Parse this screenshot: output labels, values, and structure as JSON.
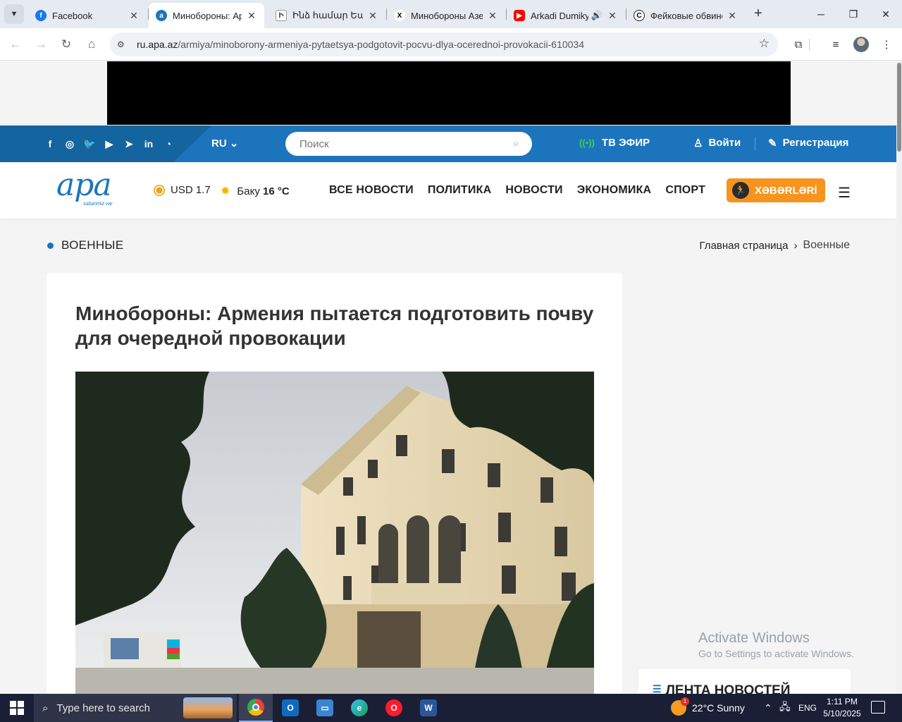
{
  "browser": {
    "tabs": [
      {
        "title": "Facebook",
        "favicon_color": "#1877f2",
        "favicon_glyph": "f",
        "active": false
      },
      {
        "title": "Минобороны: Ар",
        "favicon_color": "#1c75bc",
        "favicon_glyph": "a",
        "active": true
      },
      {
        "title": "Ինձ համար Եա...",
        "favicon_color": "#ffffff",
        "favicon_glyph": "",
        "active": false
      },
      {
        "title": "Минобороны Азе",
        "favicon_color": "#ffffff",
        "favicon_glyph": "X",
        "active": false
      },
      {
        "title": "Arkadi Dumiky",
        "favicon_color": "#ff0000",
        "favicon_glyph": "▶",
        "active": false
      },
      {
        "title": "Фейковые обвине",
        "favicon_color": "#ffffff",
        "favicon_glyph": "C",
        "active": false
      }
    ],
    "url_host": "ru.apa.az",
    "url_path": "/armiya/minoborony-armeniya-pytaetsya-podgotovit-pocvu-dlya-ocerednoi-provokacii-610034"
  },
  "site": {
    "lang": "RU",
    "search_placeholder": "Поиск",
    "tv_label": "ТВ ЭФИР",
    "login_label": "Войти",
    "register_label": "Регистрация",
    "logo_text": "apa",
    "logo_tagline": "xəbərimiz var",
    "usd_label": "USD 1.7",
    "weather_city": "Баку",
    "weather_temp": "16 °C",
    "menu": [
      "ВСЕ НОВОСТИ",
      "ПОЛИТИКА",
      "НОВОСТИ",
      "ЭКОНОМИКА",
      "СПОРТ"
    ],
    "xeber_label": "XƏBƏRLƏRİ",
    "accent_color": "#1c75bc",
    "orange_color": "#f7941d"
  },
  "section": {
    "title": "ВОЕННЫЕ",
    "breadcrumb_home": "Главная страница",
    "breadcrumb_current": "Военные"
  },
  "article": {
    "title": "Минобороны: Армения пытается подготовить почву для очередной провокации"
  },
  "sidebar": {
    "news_feed_title": "ЛЕНТА НОВОСТЕЙ"
  },
  "watermark": {
    "line1": "Activate Windows",
    "line2": "Go to Settings to activate Windows."
  },
  "taskbar": {
    "search_placeholder": "Type here to search",
    "weather": "22°C  Sunny",
    "weather_badge": "1",
    "lang": "ENG",
    "time": "1:11 PM",
    "date": "5/10/2025"
  }
}
